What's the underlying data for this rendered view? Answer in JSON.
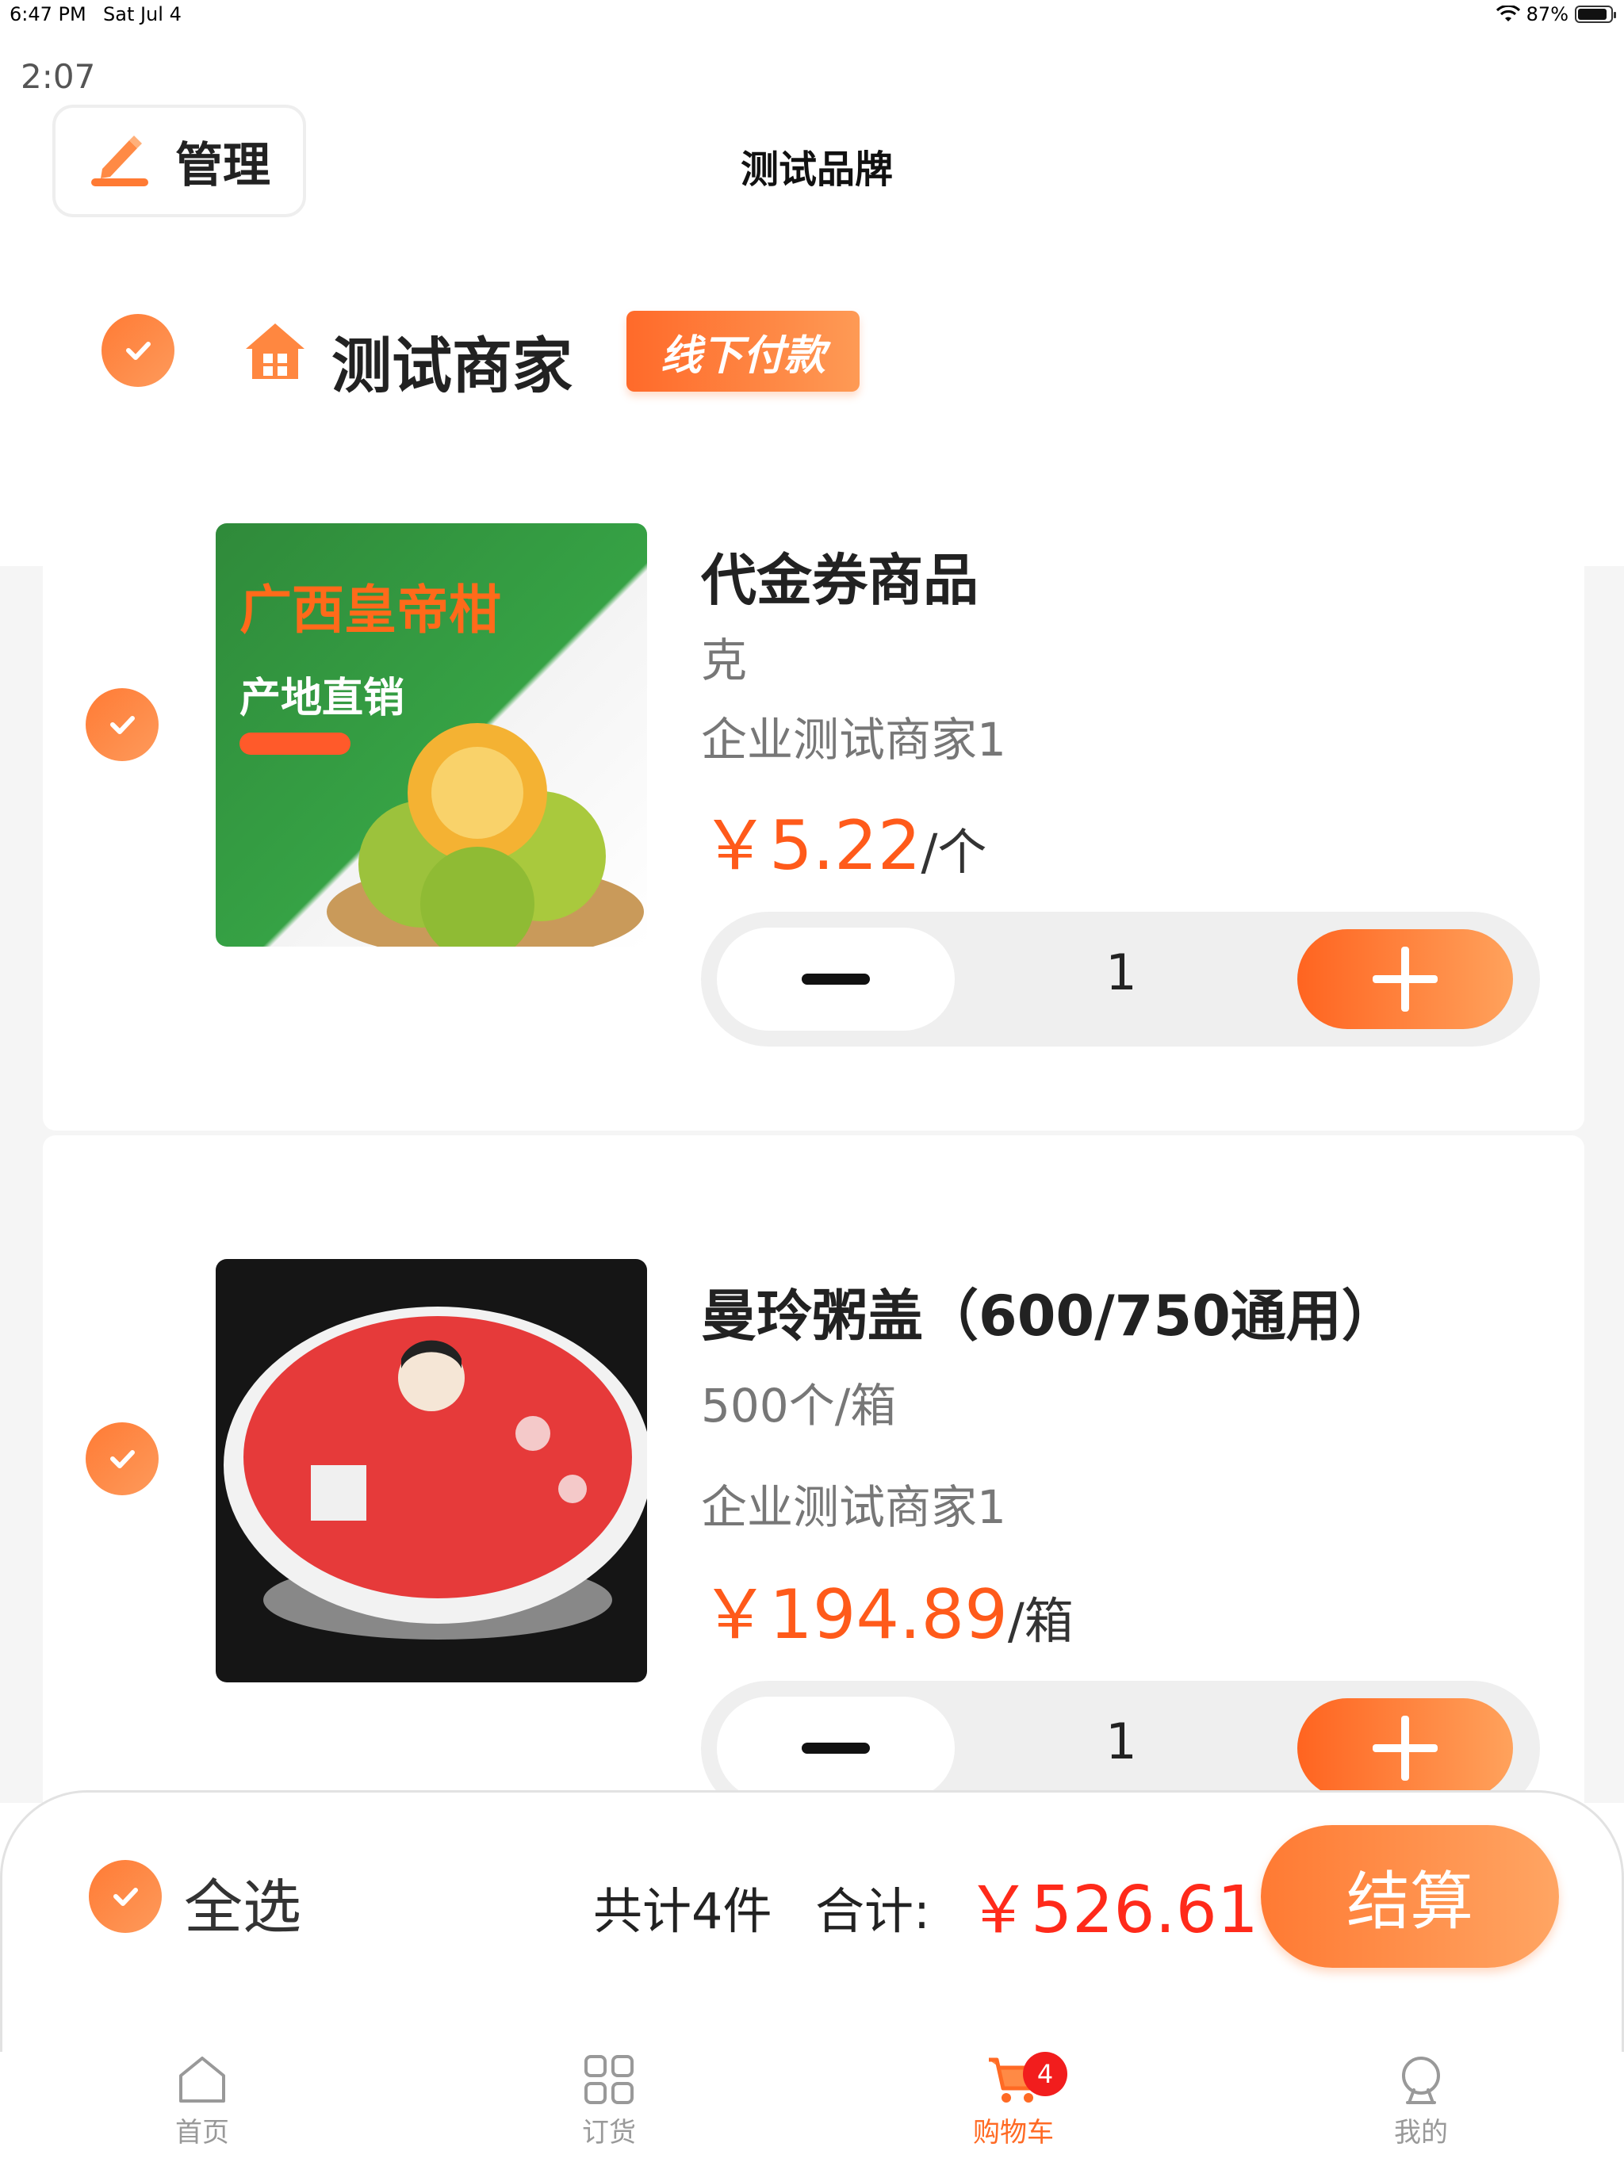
{
  "status_bar": {
    "time": "6:47 PM",
    "date": "Sat Jul 4",
    "battery": "87%"
  },
  "timer": "2:07",
  "header": {
    "manage_label": "管理",
    "title": "测试品牌"
  },
  "shop": {
    "name": "测试商家",
    "payment_badge": "线下付款"
  },
  "products": [
    {
      "name": "代金券商品",
      "spec": "克",
      "shop": "企业测试商家1",
      "price": "￥5.22",
      "unit": "/个",
      "quantity": "1",
      "image_text": {
        "title": "广西皇帝柑",
        "subtitle": "产地直销"
      }
    },
    {
      "name": "曼玲粥盖（600/750通用）",
      "spec": "500个/箱",
      "shop": "企业测试商家1",
      "price": "￥194.89",
      "unit": "/箱",
      "quantity": "1"
    }
  ],
  "footer": {
    "select_all": "全选",
    "count_text": "共计4件",
    "total_label": "合计:",
    "total_value": "￥526.61",
    "checkout": "结算"
  },
  "tabs": [
    {
      "label": "首页",
      "icon": "home-icon"
    },
    {
      "label": "订货",
      "icon": "grid-icon"
    },
    {
      "label": "购物车",
      "icon": "cart-icon",
      "badge": "4",
      "active": true
    },
    {
      "label": "我的",
      "icon": "user-icon"
    }
  ],
  "colors": {
    "accent": "#ff6a24",
    "price": "#ff5a1a",
    "total": "#ff2a1a"
  }
}
